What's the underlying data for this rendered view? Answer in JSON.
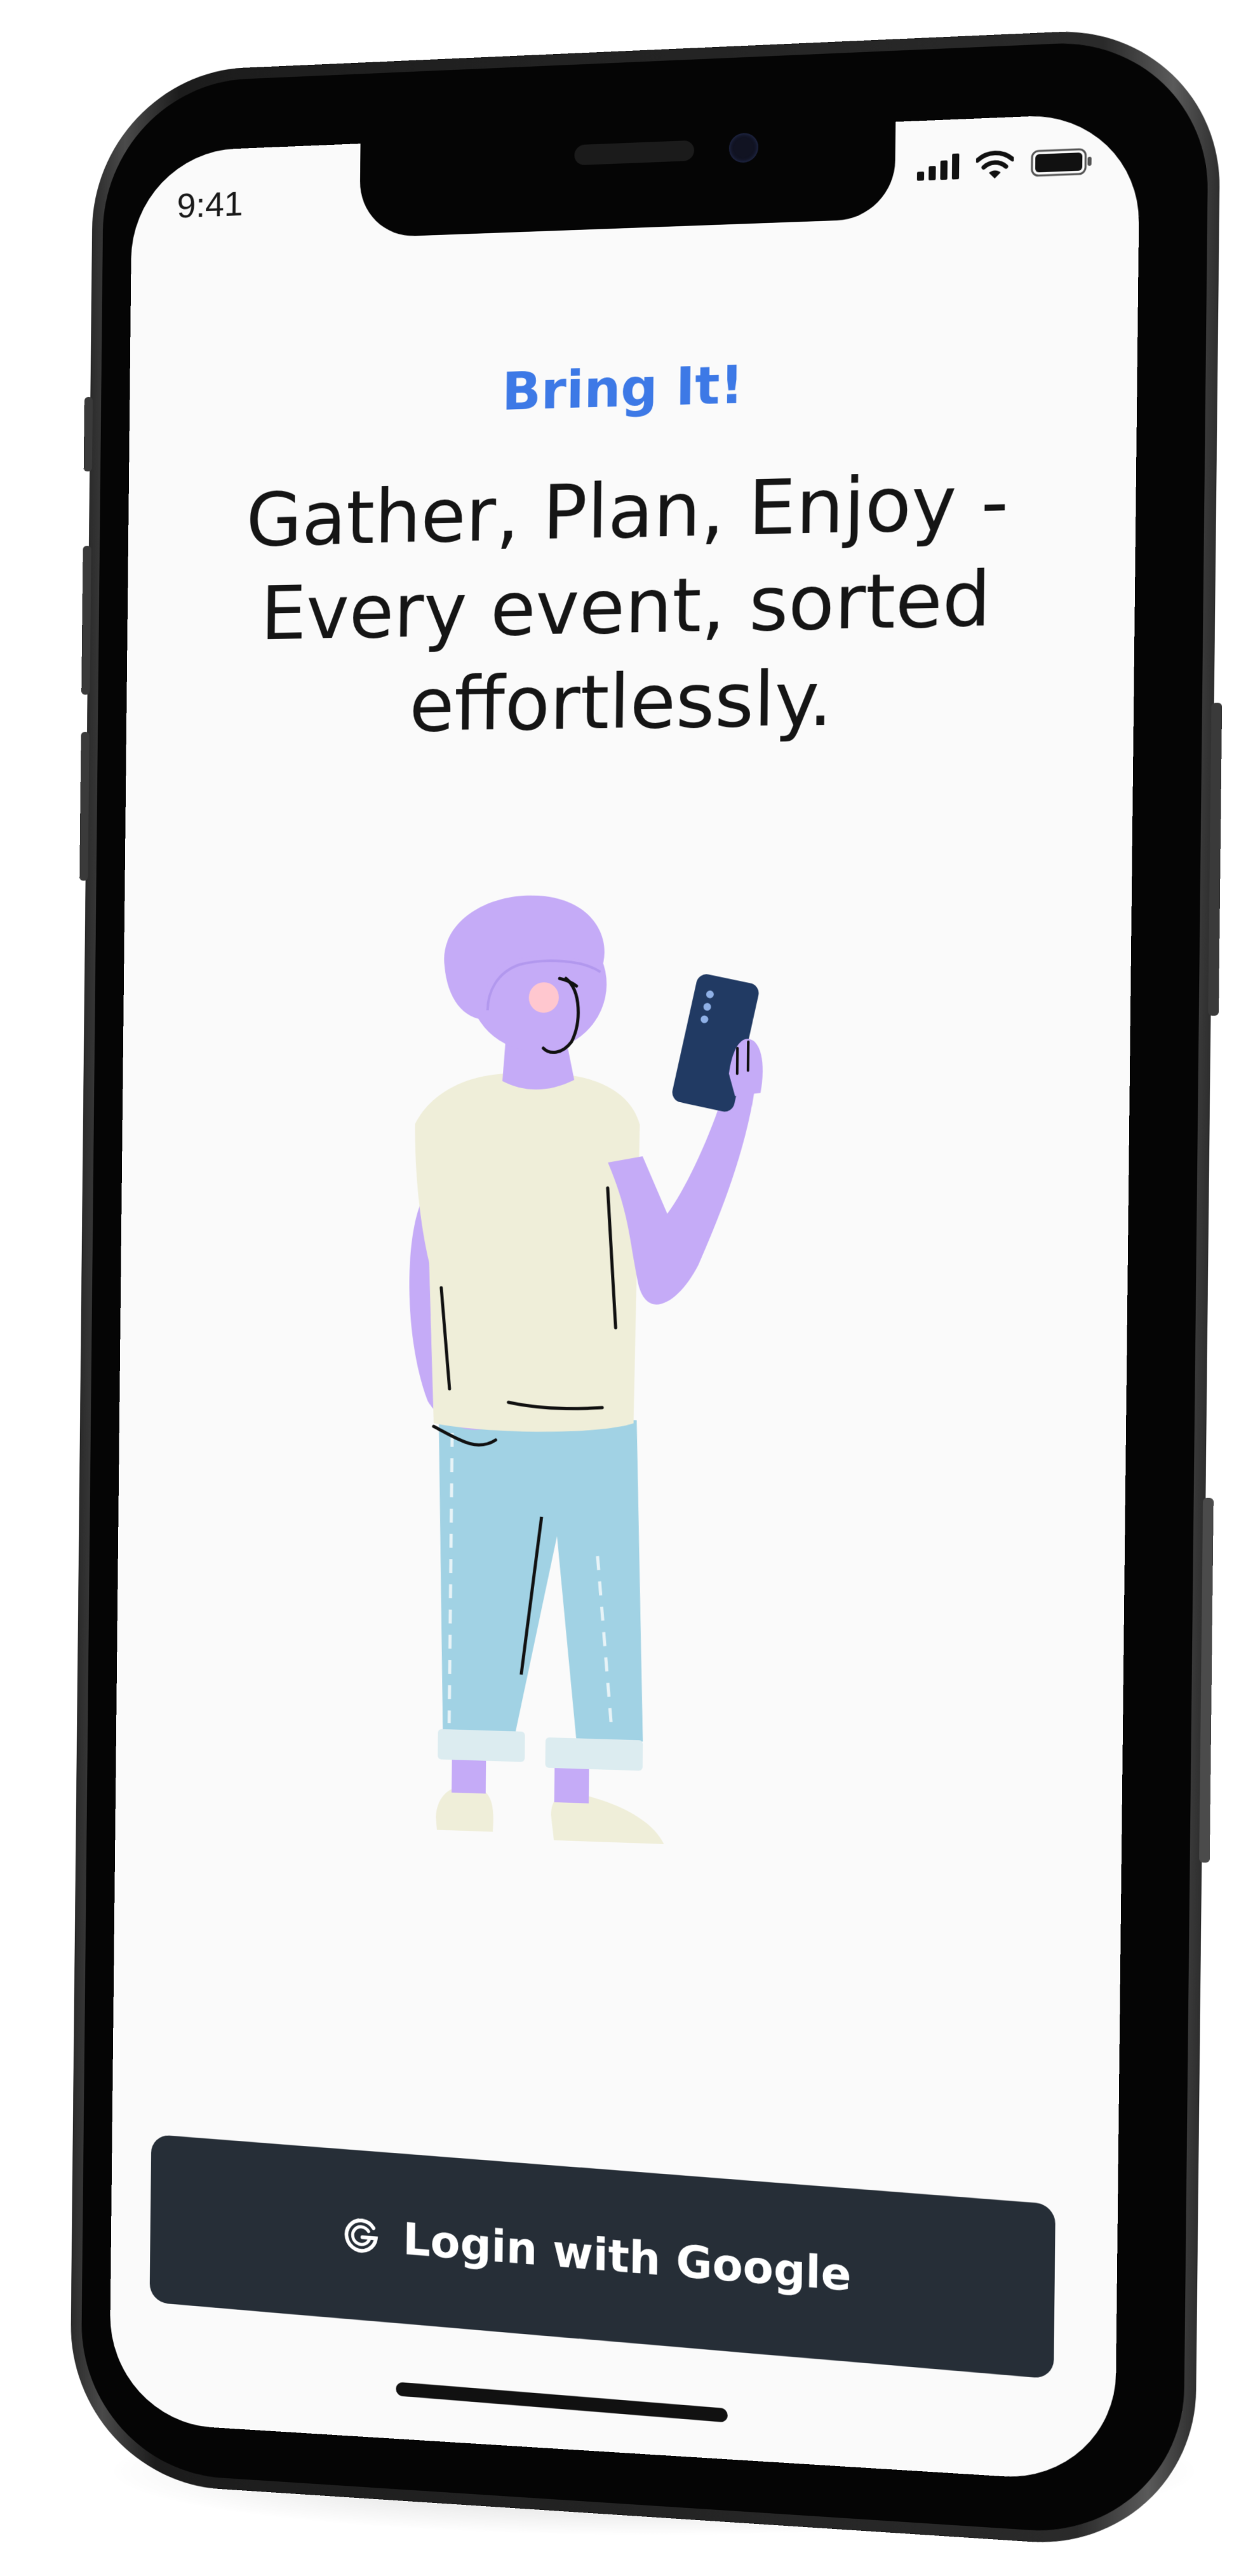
{
  "status_bar": {
    "time": "9:41",
    "icons": [
      "signal-bars-icon",
      "wifi-icon",
      "battery-icon"
    ]
  },
  "app": {
    "brand": "Bring It!",
    "headline": "Gather, Plan, Enjoy - Every event, sorted effortlessly.",
    "illustration": "person-holding-phone-illustration"
  },
  "actions": {
    "login_label": "Login with Google",
    "login_icon": "google-icon"
  },
  "colors": {
    "brand": "#3d79e6",
    "button_bg": "#262e37",
    "screen_bg": "#fafafa",
    "hair_skin": "#c5abf7",
    "shirt": "#efeed9",
    "jeans": "#a1d2e4",
    "phone": "#213a63"
  }
}
